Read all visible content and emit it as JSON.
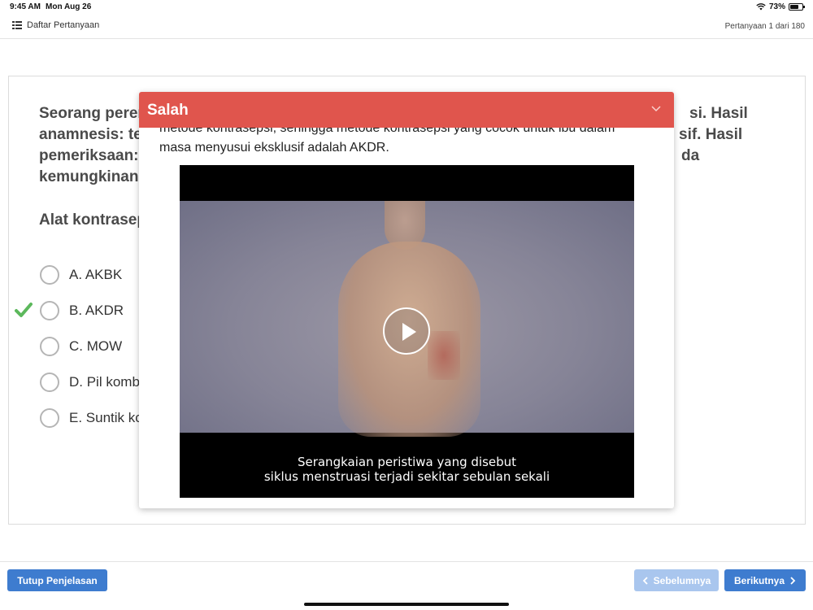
{
  "statusbar": {
    "time": "9:45 AM",
    "date": "Mon Aug 26",
    "battery": "73%",
    "battery_level": 0.73
  },
  "topbar": {
    "list_label": "Daftar Pertanyaan",
    "counter": "Pertanyaan 1 dari 180"
  },
  "question": {
    "text_visible": "Seorang perem... si. Hasil anamnesis: te... sif. Hasil pemeriksaan: ... da kemungkinan",
    "line1_left": "Seorang perem",
    "line1_right": "si. Hasil",
    "line2_left": "anamnesis:  te",
    "line2_right": "sif. Hasil",
    "line3_left": "pemeriksaan:",
    "line3_right": "da",
    "line4_left": "kemungkinan",
    "sub": "Alat kontrasep"
  },
  "options": [
    {
      "label": "A. AKBK",
      "correct": false
    },
    {
      "label": "B. AKDR",
      "correct": true
    },
    {
      "label": "C. MOW",
      "correct": false
    },
    {
      "label": "D. Pil komb",
      "correct": false
    },
    {
      "label": "E. Suntik ko",
      "correct": false
    }
  ],
  "modal": {
    "title": "Salah",
    "header_color": "#e0554d",
    "text_line1": "metode kontrasepsi, sehingga metode kontrasepsi yang cocok untuk ibu dalam",
    "text_line2": "masa menyusui eksklusif adalah AKDR.",
    "video": {
      "subtitle_line1": "Serangkaian peristiwa yang disebut",
      "subtitle_line2": "siklus menstruasi terjadi sekitar sebulan sekali"
    }
  },
  "buttons": {
    "close_explanation": "Tutup Penjelasan",
    "prev": "Sebelumnya",
    "next": "Berikutnya"
  },
  "colors": {
    "primary": "#3e7ccf",
    "primary_disabled": "#a9c6ee",
    "correct": "#5cb85c",
    "error": "#e0554d"
  }
}
